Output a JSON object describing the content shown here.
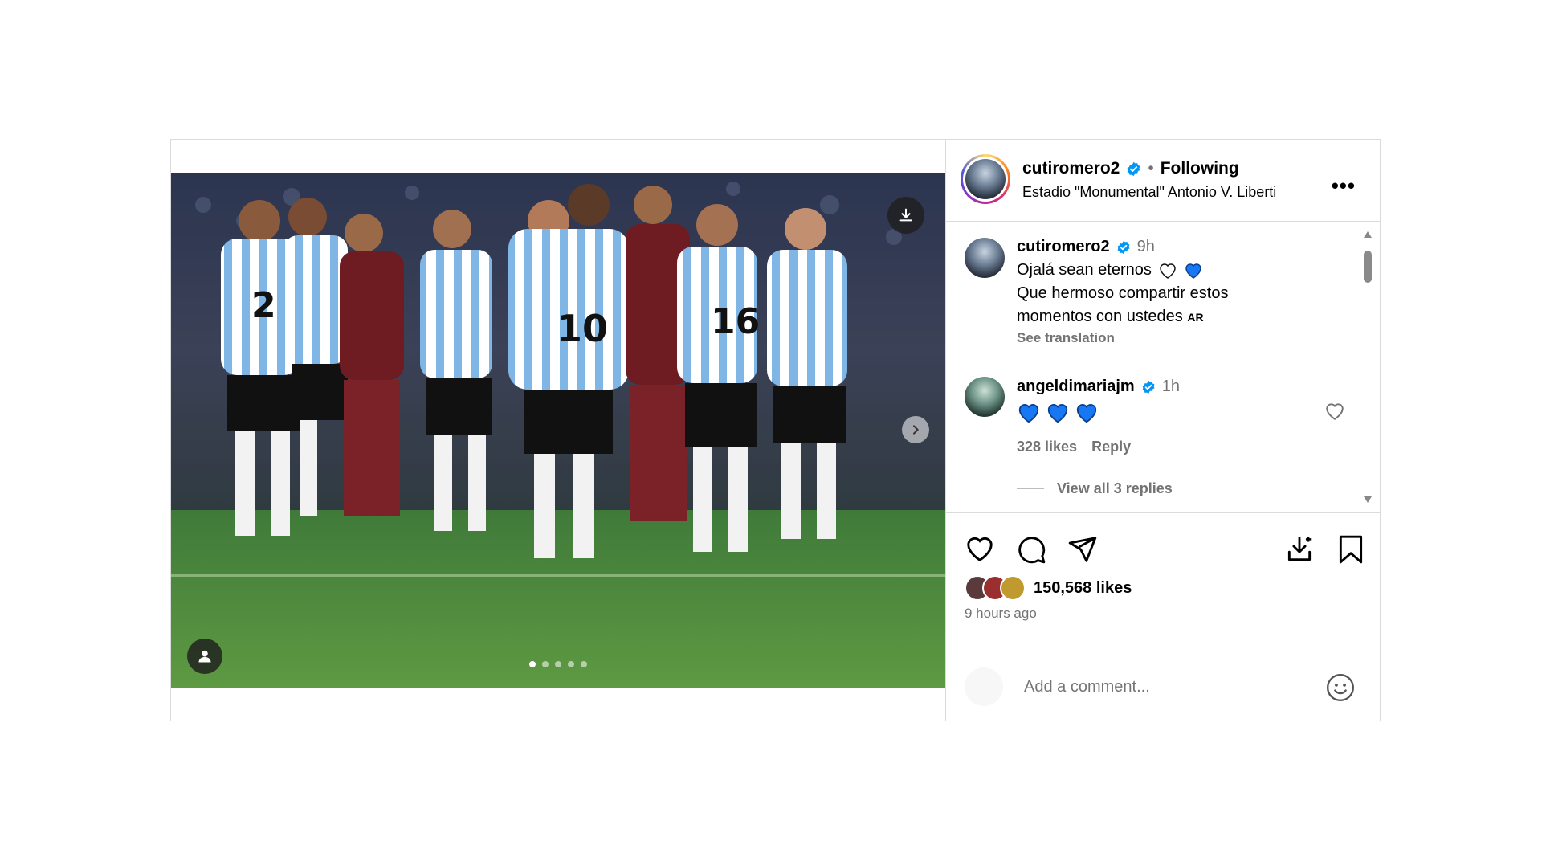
{
  "post": {
    "author": "cutiromero2",
    "separator": "•",
    "follow_status": "Following",
    "location": "Estadio \"Monumental\" Antonio V. Liberti",
    "more_label": "•••",
    "carousel": {
      "slides": 5,
      "active_index": 0
    }
  },
  "caption": {
    "username": "cutiromero2",
    "time": "9h",
    "line1": "Ojalá sean eternos",
    "line2": "Que hermoso compartir estos",
    "line3": "momentos con ustedes",
    "flag": "AR",
    "see_translation": "See translation"
  },
  "comment": {
    "username": "angeldimariajm",
    "time": "1h",
    "text_hearts": 3,
    "likes": "328 likes",
    "reply": "Reply",
    "view_replies": "View all 3 replies"
  },
  "actions": {
    "likes": "150,568 likes",
    "posted": "9 hours ago"
  },
  "add_comment": {
    "placeholder": "Add a comment..."
  },
  "colors": {
    "verified": "#0095f6",
    "blue_heart": "#1877f2",
    "border": "#dbdbdb",
    "secondary_text": "#737373"
  },
  "icons": [
    "download-icon",
    "chevron-right-icon",
    "user-tag-icon",
    "verified-badge-icon",
    "heart-icon",
    "comment-icon",
    "share-icon",
    "save-icon",
    "download-post-icon",
    "emoji-icon",
    "more-options-icon"
  ]
}
